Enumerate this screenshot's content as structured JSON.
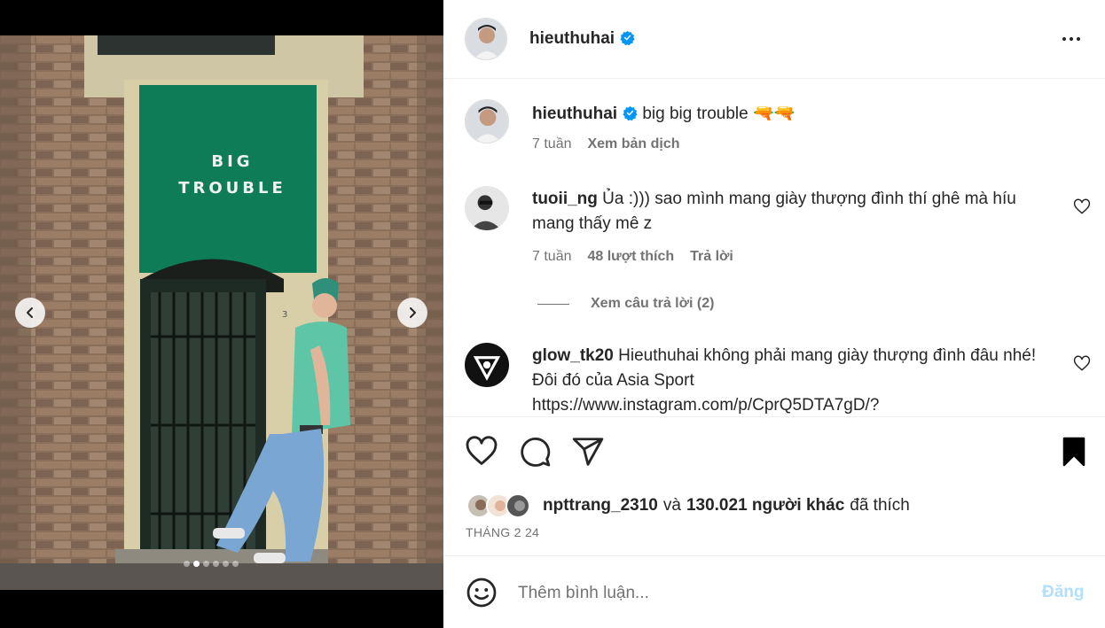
{
  "post": {
    "username": "hieuthuhai",
    "caption": {
      "text": "big big trouble 🔫🔫",
      "time": "7 tuần",
      "translate_label": "Xem bản dịch"
    },
    "sign_text": [
      "BIG",
      "TROUBLE"
    ],
    "door_number": "3",
    "carousel": {
      "total": 6,
      "current": 2
    }
  },
  "comments": [
    {
      "username": "tuoii_ng",
      "text": "Ủa :))) sao mình mang giày thượng đình thí ghê mà híu mang thấy mê z",
      "time": "7 tuần",
      "likes_label": "48 lượt thích",
      "reply_label": "Trả lời",
      "view_replies_label": "Xem câu trả lời (2)"
    },
    {
      "username": "glow_tk20",
      "text": "Hieuthuhai không phải mang giày thượng đình đâu nhé! Đôi đó của Asia Sport https://www.instagram.com/p/CprQ5DTA7gD/?"
    }
  ],
  "likes": {
    "first_user": "npttrang_2310",
    "conjunction": "và",
    "others": "130.021 người khác",
    "suffix": "đã thích"
  },
  "date": "THÁNG 2 24",
  "compose": {
    "placeholder": "Thêm bình luận...",
    "post_label": "Đăng"
  },
  "colors": {
    "verified": "#0095f6",
    "sign_green": "#0e7d57",
    "post_disabled": "#b2dffc",
    "secondary_text": "#737373"
  },
  "icons": [
    "chevron-left-icon",
    "chevron-right-icon",
    "verified-icon",
    "more-icon",
    "heart-icon",
    "comment-icon",
    "share-icon",
    "bookmark-icon",
    "emoji-icon"
  ]
}
